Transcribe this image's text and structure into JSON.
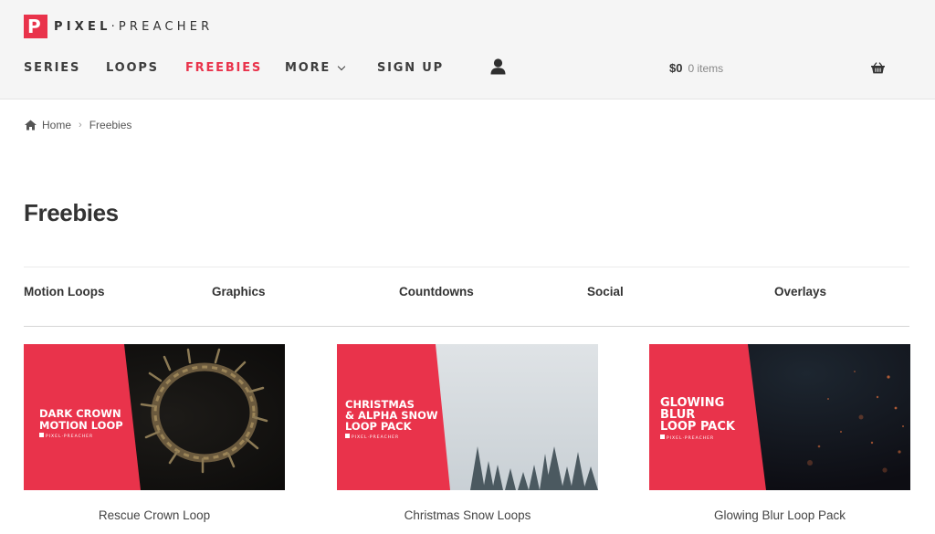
{
  "logo": {
    "mark": "P",
    "text_bold": "PIXEL",
    "text_rest": "·PREACHER"
  },
  "nav": {
    "items": [
      {
        "label": "SERIES"
      },
      {
        "label": "LOOPS"
      },
      {
        "label": "FREEBIES"
      },
      {
        "label": "MORE"
      },
      {
        "label": "SIGN UP"
      }
    ],
    "active_color": "#e9334b"
  },
  "cart": {
    "amount": "$0",
    "items": "0 items"
  },
  "breadcrumb": {
    "home": "Home",
    "current": "Freebies"
  },
  "page": {
    "title": "Freebies"
  },
  "categories": [
    {
      "label": "Motion Loops"
    },
    {
      "label": "Graphics"
    },
    {
      "label": "Countdowns"
    },
    {
      "label": "Social"
    },
    {
      "label": "Overlays"
    }
  ],
  "products": [
    {
      "title": "Rescue Crown Loop",
      "thumb_text": [
        "DARK CROWN",
        "MOTION LOOP"
      ],
      "thumb_brand": "PIXEL·PREACHER"
    },
    {
      "title": "Christmas Snow Loops",
      "thumb_text": [
        "CHRISTMAS",
        "& ALPHA SNOW",
        "LOOP PACK"
      ],
      "thumb_brand": "PIXEL·PREACHER"
    },
    {
      "title": "Glowing Blur Loop Pack",
      "thumb_text": [
        "GLOWING",
        "BLUR",
        "LOOP PACK"
      ],
      "thumb_brand": "PIXEL·PREACHER"
    }
  ],
  "colors": {
    "brand_red": "#e9334b",
    "header_bg": "#f5f5f5"
  }
}
